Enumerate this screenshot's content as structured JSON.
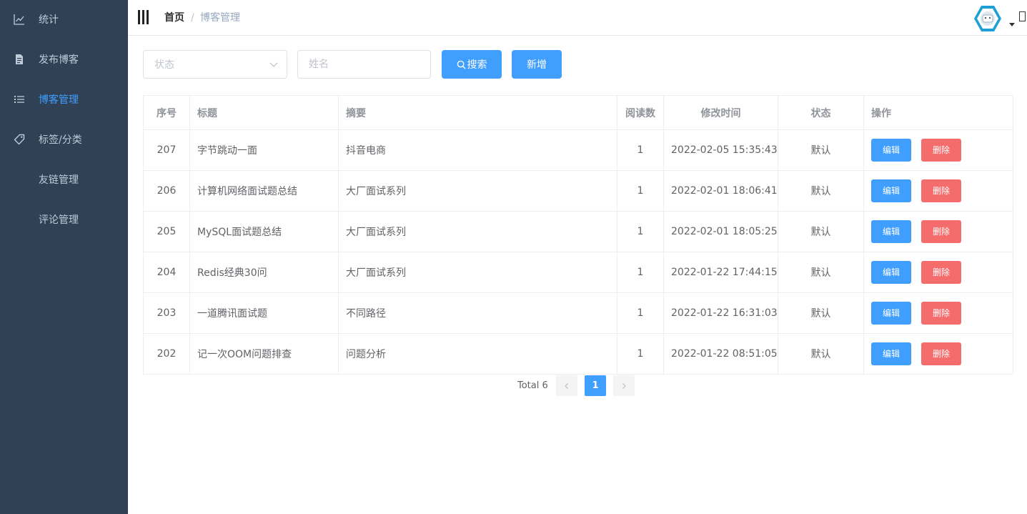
{
  "sidebar": {
    "items": [
      {
        "label": "统计",
        "icon": "chart-icon",
        "active": false
      },
      {
        "label": "发布博客",
        "icon": "document-icon",
        "active": false
      },
      {
        "label": "博客管理",
        "icon": "list-icon",
        "active": true
      },
      {
        "label": "标签/分类",
        "icon": "tag-icon",
        "active": false
      },
      {
        "label": "友链管理",
        "icon": "",
        "active": false
      },
      {
        "label": "评论管理",
        "icon": "",
        "active": false
      }
    ],
    "bg_color": "#304156",
    "active_color": "#409eff"
  },
  "header": {
    "breadcrumb_home": "首页",
    "breadcrumb_sep": "/",
    "breadcrumb_current": "博客管理"
  },
  "filters": {
    "status_placeholder": "状态",
    "name_placeholder": "姓名",
    "search_label": "搜索",
    "add_label": "新增"
  },
  "table": {
    "headers": [
      "序号",
      "标题",
      "摘要",
      "阅读数",
      "修改时间",
      "状态",
      "操作"
    ],
    "edit_label": "编辑",
    "delete_label": "删除",
    "rows": [
      {
        "id": "207",
        "title": "字节跳动一面",
        "summary": "抖音电商",
        "reads": "1",
        "time": "2022-02-05 15:35:43",
        "status": "默认"
      },
      {
        "id": "206",
        "title": "计算机网络面试题总结",
        "summary": "大厂面试系列",
        "reads": "1",
        "time": "2022-02-01 18:06:41",
        "status": "默认"
      },
      {
        "id": "205",
        "title": "MySQL面试题总结",
        "summary": "大厂面试系列",
        "reads": "1",
        "time": "2022-02-01 18:05:25",
        "status": "默认"
      },
      {
        "id": "204",
        "title": "Redis经典30问",
        "summary": "大厂面试系列",
        "reads": "1",
        "time": "2022-01-22 17:44:15",
        "status": "默认"
      },
      {
        "id": "203",
        "title": "一道腾讯面试题",
        "summary": "不同路径",
        "reads": "1",
        "time": "2022-01-22 16:31:03",
        "status": "默认"
      },
      {
        "id": "202",
        "title": "记一次OOM问题排查",
        "summary": "问题分析",
        "reads": "1",
        "time": "2022-01-22 08:51:05",
        "status": "默认"
      }
    ]
  },
  "pagination": {
    "total_text": "Total 6",
    "current_page": "1"
  },
  "colors": {
    "primary": "#409eff",
    "danger": "#f56c6c"
  }
}
